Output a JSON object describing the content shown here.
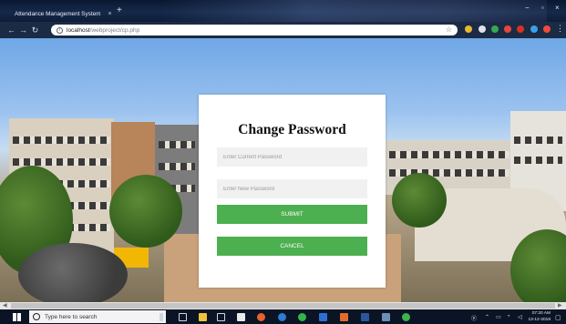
{
  "browser": {
    "tab_title": "Attendance Management System",
    "tab_close": "×",
    "new_tab": "+",
    "url_host": "localhost",
    "url_path": "/webproject/cp.php",
    "window_controls": {
      "minimize": "−",
      "maximize": "▫",
      "close": "×"
    }
  },
  "form": {
    "title": "Change Password",
    "current_password_placeholder": "Enter Current Password",
    "new_password_placeholder": "Enter New Password",
    "submit_label": "SUBMIT",
    "cancel_label": "CANCEL"
  },
  "taskbar": {
    "search_placeholder": "Type here to search",
    "time": "07:20 AM",
    "date": "13-12-2018"
  },
  "colors": {
    "button_green": "#4caf50",
    "field_bg": "#f1f1f1",
    "tab_favicon": "#e8692a"
  }
}
